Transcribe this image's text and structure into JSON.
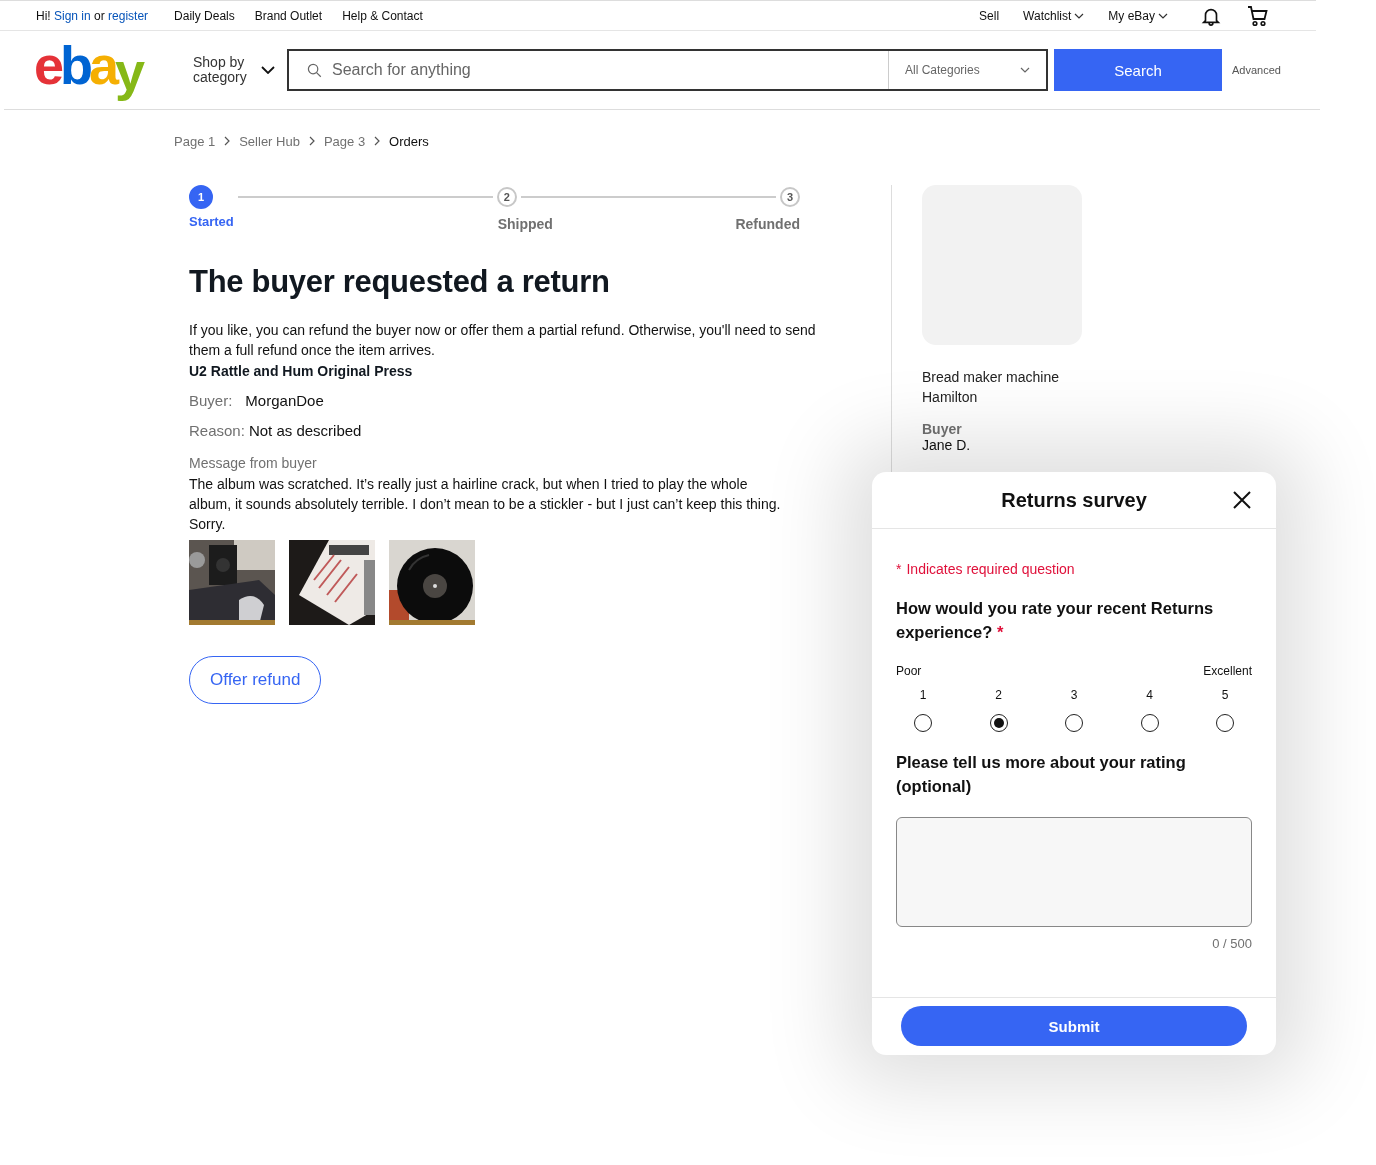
{
  "top_bar": {
    "greeting": "Hi!",
    "sign_in": "Sign in",
    "or": "or",
    "register": "register",
    "links": [
      "Daily Deals",
      "Brand Outlet",
      "Help & Contact"
    ],
    "right_links": [
      {
        "label": "Sell",
        "kind": "plain"
      },
      {
        "label": "Watchlist",
        "kind": "dropdown"
      },
      {
        "label": "My eBay",
        "kind": "dropdown"
      }
    ]
  },
  "header": {
    "logo": [
      {
        "char": "e",
        "color": "#e53238"
      },
      {
        "char": "b",
        "color": "#0064d2"
      },
      {
        "char": "a",
        "color": "#f5af02"
      },
      {
        "char": "y",
        "color": "#86b817"
      }
    ],
    "shop_by": "Shop by category",
    "search_placeholder": "Search for anything",
    "category": "All Categories",
    "search_button": "Search",
    "advanced": "Advanced"
  },
  "breadcrumbs": [
    {
      "label": "Page 1",
      "current": false
    },
    {
      "label": "Seller Hub",
      "current": false
    },
    {
      "label": "Page 3",
      "current": false
    },
    {
      "label": "Orders",
      "current": true
    }
  ],
  "stepper": [
    {
      "number": "1",
      "label": "Started",
      "selected": true
    },
    {
      "number": "2",
      "label": "Shipped",
      "selected": false
    },
    {
      "number": "3",
      "label": "Refunded",
      "selected": false
    }
  ],
  "title": "The buyer requested a return",
  "intro": "If you like, you can refund the buyer now or offer them a partial refund. Otherwise, you'll need to send them a full refund once the item arrives.",
  "item_name": "U2 Rattle and Hum Original Press",
  "buyer": {
    "label": "Buyer:",
    "value": "MorganDoe"
  },
  "reason": {
    "label": "Reason:",
    "value": "Not as described"
  },
  "message": {
    "label": "Message from buyer",
    "text": "The album was scratched. It’s really just a hairline crack, but when I tried to play the whole album, it sounds absolutely terrible. I don’t mean to be a stickler - but I just can’t keep this thing. Sorry."
  },
  "offer_button": "Offer refund",
  "sidebar": {
    "product": "Bread maker machine Hamilton",
    "buyer_label": "Buyer",
    "buyer_name": "Jane D."
  },
  "survey": {
    "title": "Returns survey",
    "required_note": "Indicates required question",
    "note_mark": "*",
    "required_mark": "*",
    "question": "How would you rate your recent Returns experience?",
    "low_label": "Poor",
    "high_label": "Excellent",
    "ratings": [
      {
        "label": "1",
        "selected": false
      },
      {
        "label": "2",
        "selected": true
      },
      {
        "label": "3",
        "selected": false
      },
      {
        "label": "4",
        "selected": false
      },
      {
        "label": "5",
        "selected": false
      }
    ],
    "comment_question": "Please tell us more about your rating (optional)",
    "counter": "0 / 500",
    "submit": "Submit"
  }
}
